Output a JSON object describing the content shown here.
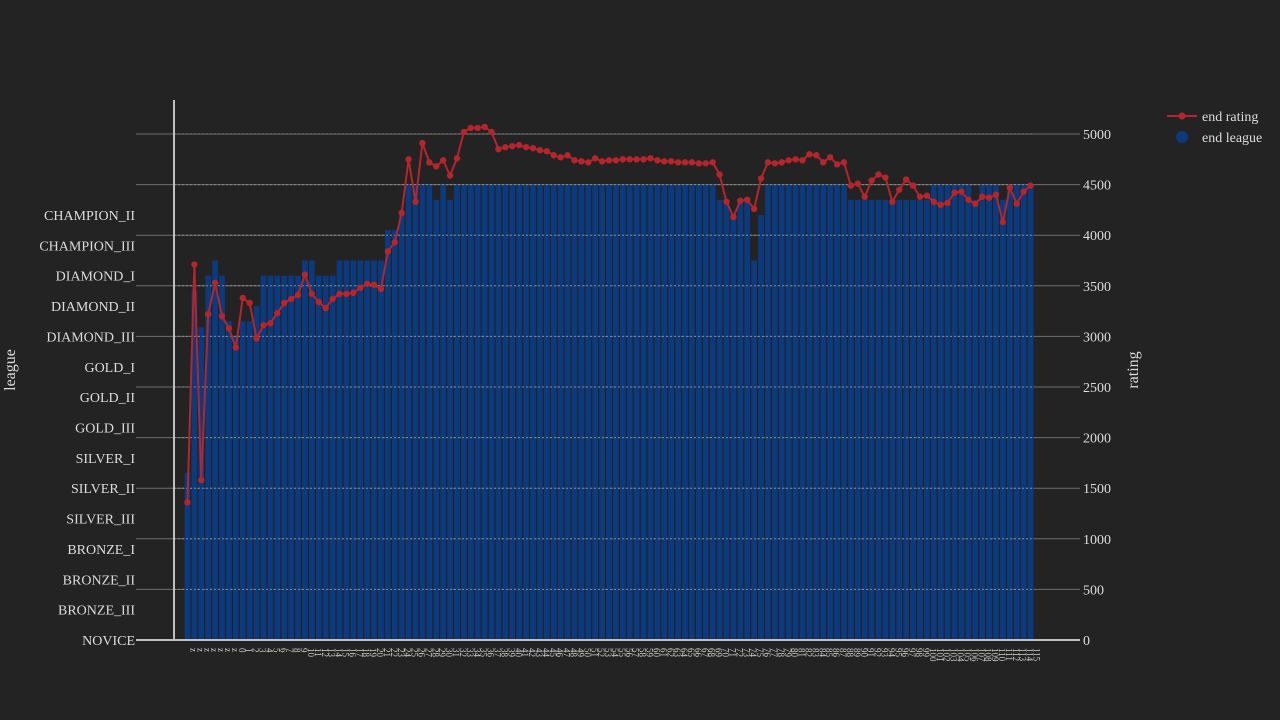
{
  "chart_data": {
    "type": "bar",
    "y_left_title": "league",
    "y_right_title": "rating",
    "y_left_categories": [
      "NOVICE",
      "BRONZE_III",
      "BRONZE_II",
      "BRONZE_I",
      "SILVER_III",
      "SILVER_II",
      "SILVER_I",
      "GOLD_III",
      "GOLD_II",
      "GOLD_I",
      "DIAMOND_III",
      "DIAMOND_II",
      "DIAMOND_I",
      "CHAMPION_III",
      "CHAMPION_II"
    ],
    "y_right_range": [
      0,
      5000
    ],
    "y_right_ticks": [
      0,
      500,
      1000,
      1500,
      2000,
      2500,
      3000,
      3500,
      4000,
      4500,
      5000
    ],
    "grid": true,
    "legend_position": "top-right",
    "series": [
      {
        "name": "end rating",
        "type": "line",
        "color": "#b5252c",
        "values": [
          1360,
          3710,
          1580,
          3220,
          3530,
          3200,
          3080,
          2890,
          3380,
          3330,
          2980,
          3110,
          3130,
          3230,
          3330,
          3370,
          3410,
          3610,
          3420,
          3340,
          3280,
          3370,
          3420,
          3420,
          3430,
          3480,
          3520,
          3510,
          3470,
          3840,
          3930,
          4220,
          4750,
          4330,
          4910,
          4720,
          4680,
          4740,
          4590,
          4760,
          5020,
          5060,
          5060,
          5070,
          5020,
          4850,
          4870,
          4880,
          4890,
          4870,
          4860,
          4840,
          4830,
          4790,
          4770,
          4790,
          4740,
          4730,
          4720,
          4760,
          4730,
          4740,
          4740,
          4750,
          4750,
          4750,
          4750,
          4760,
          4740,
          4730,
          4730,
          4720,
          4720,
          4720,
          4710,
          4710,
          4720,
          4600,
          4330,
          4180,
          4340,
          4350,
          4260,
          4560,
          4720,
          4710,
          4720,
          4740,
          4750,
          4740,
          4800,
          4790,
          4720,
          4770,
          4700,
          4720,
          4490,
          4510,
          4380,
          4540,
          4600,
          4570,
          4330,
          4450,
          4550,
          4490,
          4380,
          4390,
          4330,
          4300,
          4320,
          4420,
          4430,
          4350,
          4310,
          4380,
          4370,
          4400,
          4130,
          4470,
          4310,
          4430,
          4490
        ]
      },
      {
        "name": "end league",
        "type": "bar",
        "color": "#0b3a7e",
        "values": [
          5.5,
          11.5,
          10.3,
          12,
          12.5,
          12,
          10.5,
          10,
          10.5,
          10.5,
          11,
          12,
          12,
          12,
          12,
          12,
          12,
          12.5,
          12.5,
          12,
          12,
          12,
          12.5,
          12.5,
          12.5,
          12.5,
          12.5,
          12.5,
          12.5,
          13.5,
          13.5,
          14,
          15,
          15,
          15,
          15,
          14.5,
          15,
          14.5,
          15,
          15,
          15,
          15,
          15,
          15,
          15,
          15,
          15,
          15,
          15,
          15,
          15,
          15,
          15,
          15,
          15,
          15,
          15,
          15,
          15,
          15,
          15,
          15,
          15,
          15,
          15,
          15,
          15,
          15,
          15,
          15,
          15,
          15,
          15,
          15,
          15,
          15,
          14.5,
          14.5,
          14,
          14.5,
          14.5,
          12.5,
          14,
          15,
          15,
          15,
          15,
          15,
          15,
          15,
          15,
          15,
          15,
          15,
          15,
          14.5,
          14.5,
          14.5,
          14.5,
          14.5,
          14.5,
          14.5,
          14.5,
          14.5,
          14.5,
          14.5,
          14.5,
          15,
          15,
          15,
          15,
          15,
          15,
          14.5,
          15,
          15,
          15,
          14.5,
          15,
          15,
          15,
          15
        ]
      }
    ],
    "x": [
      "z",
      "z",
      "z",
      "z",
      "z",
      "z",
      "z",
      "0",
      "1",
      "2",
      "3",
      "4",
      "5",
      "6",
      "7",
      "8",
      "9",
      "10",
      "11",
      "12",
      "13",
      "14",
      "15",
      "16",
      "17",
      "18",
      "19",
      "20",
      "21",
      "22",
      "23",
      "24",
      "25",
      "26",
      "27",
      "28",
      "29",
      "30",
      "31",
      "32",
      "33",
      "34",
      "35",
      "36",
      "37",
      "38",
      "39",
      "40",
      "41",
      "42",
      "43",
      "44",
      "45",
      "46",
      "47",
      "48",
      "49",
      "50",
      "51",
      "52",
      "53",
      "54",
      "55",
      "56",
      "57",
      "58",
      "59",
      "60",
      "61",
      "62",
      "63",
      "64",
      "65",
      "66",
      "67",
      "68",
      "69",
      "70",
      "71",
      "72",
      "73",
      "74",
      "75",
      "76",
      "77",
      "78",
      "79",
      "80",
      "81",
      "82",
      "83",
      "84",
      "85",
      "86",
      "87",
      "88",
      "89",
      "90",
      "91",
      "92",
      "93",
      "94",
      "95",
      "96",
      "97",
      "98",
      "99",
      "100",
      "101",
      "102",
      "103",
      "104",
      "105",
      "106",
      "107",
      "108",
      "109",
      "110",
      "111",
      "112",
      "113",
      "114",
      "115"
    ]
  }
}
